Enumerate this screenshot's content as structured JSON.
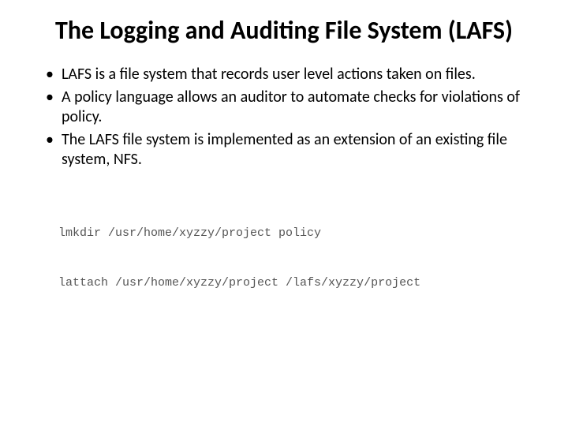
{
  "title": "The Logging and Auditing File System (LAFS)",
  "bullets": [
    "LAFS is a file system that records user level actions taken on files.",
    "A policy language allows an auditor to automate checks for violations of policy.",
    "The LAFS file system is implemented as an extension of an existing file system, NFS."
  ],
  "code_lines": [
    "lmkdir /usr/home/xyzzy/project policy",
    "lattach /usr/home/xyzzy/project /lafs/xyzzy/project"
  ]
}
